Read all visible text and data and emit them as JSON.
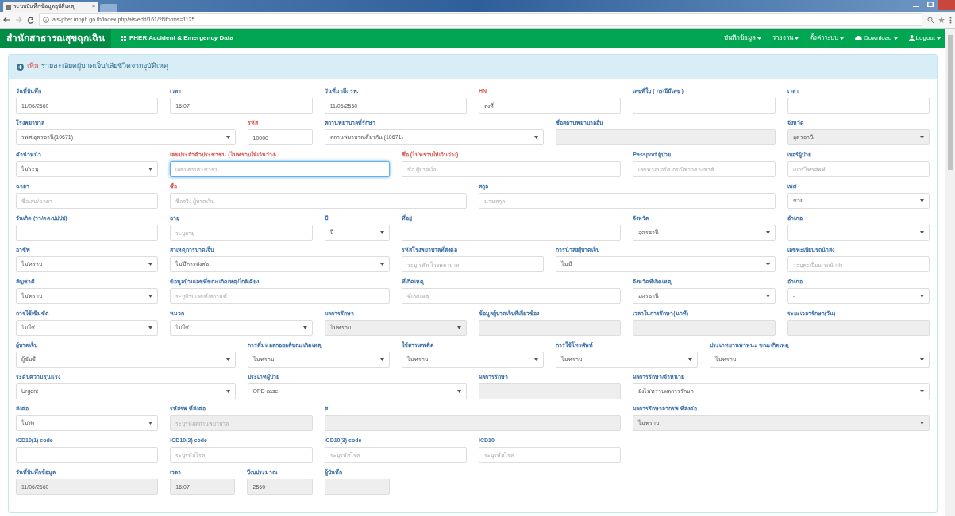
{
  "browser": {
    "tab_title": "ระบบบันทึกข้อมูลอุบัติเหตุ",
    "tab_close": "×",
    "url": "ais-pher.moph.go.th/index.php/ais/edit/161/?Nforms=1125"
  },
  "navbar": {
    "brand": "สำนักสาธารณสุขฉุกเฉิน",
    "subtitle": "PHER Accident & Emergency Data",
    "menu": [
      {
        "label": "บันทึกข้อมูล",
        "kind": "plain"
      },
      {
        "label": "รายงาน",
        "kind": "plain"
      },
      {
        "label": "ตั้งค่าระบบ",
        "kind": "plain"
      },
      {
        "label": "Download",
        "kind": "download"
      },
      {
        "label": "Logout",
        "kind": "account"
      }
    ]
  },
  "panel": {
    "title_action": "เพิ่ม",
    "title": "รายละเอียดผู้บาดเจ็บ/เสียชีวิตจากอุบัติเหตุ"
  },
  "form": {
    "rows": [
      {
        "fields": [
          {
            "kind": "text",
            "label": "วันที่บันทึก",
            "value": "11/06/2560",
            "required": false,
            "disabled": false,
            "focused": false
          },
          {
            "kind": "text",
            "label": "เวลา",
            "value": "16:07",
            "required": false,
            "disabled": false,
            "focused": false
          },
          {
            "kind": "text",
            "label": "วันที่มาถึง รพ.",
            "value": "11/06/2560",
            "required": false,
            "disabled": false,
            "focused": false
          },
          {
            "kind": "text",
            "label": "HN",
            "value": "ลงที่",
            "required": true,
            "disabled": false,
            "focused": false
          },
          {
            "kind": "text",
            "label": "เลขที่ใบ ( กรณีมีเลข )",
            "required": false,
            "disabled": false,
            "focused": false
          },
          {
            "kind": "text",
            "label": "เวลา",
            "required": false,
            "disabled": false,
            "focused": false
          }
        ]
      },
      {
        "fields": [
          {
            "kind": "select",
            "label": "โรงพยาบาล",
            "value": "รพศ.อุดรธานี(10671)",
            "required": false,
            "disabled": false,
            "focused": false
          },
          {
            "kind": "text",
            "label": "รหัส",
            "value": "10000",
            "required": true,
            "disabled": false,
            "focused": false
          },
          {
            "kind": "select",
            "label": "สถานพยาบาลที่รักษา",
            "value": "สถานพยาบาลเดียวกัน (10671)",
            "required": false,
            "disabled": false,
            "focused": false
          },
          {
            "kind": "text",
            "label": "ชื่อสถานพยาบาลอื่น",
            "required": false,
            "disabled": true,
            "focused": false
          },
          {
            "kind": "select",
            "label": "จังหวัด",
            "value": "อุดรธานี",
            "required": false,
            "disabled": true,
            "focused": false
          }
        ]
      },
      {
        "fields": [
          {
            "kind": "select",
            "label": "คำนำหน้า",
            "value": "ไม่ระบุ",
            "required": false,
            "disabled": false,
            "focused": false
          },
          {
            "kind": "text",
            "label": "เลขประจำตัวประชาชน (ไม่ทราบให้เว้นว่าง)",
            "placeholder": "เลขบัตรประชาชน",
            "required": true,
            "disabled": false,
            "focused": true
          },
          {
            "kind": "text",
            "label": "ชื่อ (ไม่ทราบให้เว้นว่าง)",
            "placeholder": "ชื่อ ผู้บาดเจ็บ",
            "required": true,
            "disabled": false,
            "focused": false
          },
          {
            "kind": "text",
            "label": "Passport ผู้ป่วย",
            "placeholder": "เลขพาสปอร์ต กรณีชาวต่างชาติ",
            "required": false,
            "disabled": false,
            "focused": false
          },
          {
            "kind": "text",
            "label": "เบอร์ผู้ป่วย",
            "placeholder": "เบอร์โทรศัพท์",
            "required": false,
            "disabled": false,
            "focused": false
          }
        ]
      },
      {
        "fields": [
          {
            "kind": "text",
            "label": "ฉายา",
            "placeholder": "ชื่อเล่น/ฉายา",
            "required": false,
            "disabled": false,
            "focused": false
          },
          {
            "kind": "text",
            "label": "ชื่อ",
            "placeholder": "ชื่อจริง ผู้บาดเจ็บ",
            "required": true,
            "disabled": false,
            "focused": false
          },
          {
            "kind": "text",
            "label": "สกุล",
            "placeholder": "นามสกุล",
            "required": false,
            "disabled": false,
            "focused": false
          },
          {
            "kind": "select",
            "label": "เพศ",
            "value": "ชาย",
            "required": false,
            "disabled": false,
            "focused": false
          }
        ]
      },
      {
        "fields": [
          {
            "kind": "text",
            "label": "วันเกิด (วว/ดด/ปปปป)",
            "required": false,
            "disabled": false,
            "focused": false
          },
          {
            "kind": "text",
            "label": "อายุ",
            "placeholder": "ระบุอายุ",
            "required": false,
            "disabled": false,
            "focused": false
          },
          {
            "kind": "select",
            "label": "ปี",
            "value": "ปี",
            "required": false,
            "disabled": false,
            "focused": false
          },
          {
            "kind": "text",
            "label": "ที่อยู่",
            "required": false,
            "disabled": false,
            "focused": false
          },
          {
            "kind": "select",
            "label": "จังหวัด",
            "value": "อุดรธานี",
            "required": false,
            "disabled": false,
            "focused": false
          },
          {
            "kind": "select",
            "label": "อำเภอ",
            "value": "-",
            "required": false,
            "disabled": false,
            "focused": false
          }
        ]
      },
      {
        "fields": [
          {
            "kind": "select",
            "label": "อาชีพ",
            "value": "ไม่ทราบ",
            "required": false,
            "disabled": false,
            "focused": false
          },
          {
            "kind": "select",
            "label": "สาเหตุการบาดเจ็บ",
            "value": "ไม่มีการส่งต่อ",
            "required": false,
            "disabled": false,
            "focused": false
          },
          {
            "kind": "text",
            "label": "รหัสโรงพยาบาลที่ส่งต่อ",
            "placeholder": "ระบุ รหัส โรงพยาบาล",
            "required": false,
            "disabled": false,
            "focused": false
          },
          {
            "kind": "select",
            "label": "การนำส่งผู้บาดเจ็บ",
            "value": "ไม่มี",
            "required": false,
            "disabled": false,
            "focused": false
          },
          {
            "kind": "text",
            "label": "เลขทะเบียนรถนำส่ง",
            "placeholder": "ระบุทะเบียน รถนำส่ง",
            "required": false,
            "disabled": false,
            "focused": false
          }
        ]
      },
      {
        "fields": [
          {
            "kind": "select",
            "label": "สัญชาติ",
            "value": "ไม่ทราบ",
            "required": false,
            "disabled": false,
            "focused": false
          },
          {
            "kind": "text",
            "label": "ข้อมูลบ้านเลขที่ขณะเกิดเหตุ/ใกล้เคียง",
            "placeholder": "ระบุบ้านเลขที่/สถานที่",
            "required": false,
            "disabled": false,
            "focused": false
          },
          {
            "kind": "text",
            "label": "ที่เกิดเหตุ",
            "placeholder": "ที่เกิดเหตุ",
            "required": false,
            "disabled": false,
            "focused": false
          },
          {
            "kind": "select",
            "label": "จังหวัดที่เกิดเหตุ",
            "value": "อุดรธานี",
            "required": false,
            "disabled": false,
            "focused": false
          },
          {
            "kind": "select",
            "label": "อำเภอ",
            "value": "-",
            "required": false,
            "disabled": false,
            "focused": false
          }
        ]
      },
      {
        "fields": [
          {
            "kind": "select",
            "label": "การใช้เข็มขัด",
            "value": "ไม่ใช่",
            "required": false,
            "disabled": false,
            "focused": false
          },
          {
            "kind": "select",
            "label": "หมวก",
            "value": "ไม่ใช่",
            "required": false,
            "disabled": false,
            "focused": false
          },
          {
            "kind": "select",
            "label": "ผลการรักษา",
            "value": "ไม่ทราบ",
            "required": false,
            "disabled": true,
            "focused": false
          },
          {
            "kind": "text",
            "label": "ข้อมูลผู้บาดเจ็บที่เกี่ยวข้อง",
            "required": false,
            "disabled": true,
            "focused": false
          },
          {
            "kind": "text",
            "label": "เวลาในการรักษา(นาที)",
            "required": false,
            "disabled": true,
            "focused": false
          },
          {
            "kind": "text",
            "label": "ระยะเวลารักษา(วัน)",
            "required": false,
            "disabled": true,
            "focused": false
          }
        ]
      },
      {
        "fields": [
          {
            "kind": "select",
            "label": "ผู้บาดเจ็บ",
            "value": "ผู้ขับขี่",
            "required": false,
            "disabled": false,
            "focused": false
          },
          {
            "kind": "select",
            "label": "การดื่มแอลกอฮอล์ขณะเกิดเหตุ",
            "value": "ไม่ทราบ",
            "required": false,
            "disabled": false,
            "focused": false
          },
          {
            "kind": "select",
            "label": "ใช้สารเสพติด",
            "value": "ไม่ทราบ",
            "required": false,
            "disabled": false,
            "focused": false
          },
          {
            "kind": "select",
            "label": "การใช้โทรศัพท์",
            "value": "ไม่ทราบ",
            "required": false,
            "disabled": false,
            "focused": false
          },
          {
            "kind": "select",
            "label": "ประเภทยานพาหนะ ขณะเกิดเหตุ",
            "value": "ไม่ทราบ",
            "required": false,
            "disabled": false,
            "focused": false
          }
        ]
      },
      {
        "fields": [
          {
            "kind": "select",
            "label": "ระดับความรุนแรง",
            "value": "Urgent",
            "required": false,
            "disabled": false,
            "focused": false
          },
          {
            "kind": "select",
            "label": "ประเภทผู้ป่วย",
            "value": "OPD case",
            "required": false,
            "disabled": false,
            "focused": false
          },
          {
            "kind": "text",
            "label": "ผลการรักษา",
            "required": false,
            "disabled": true,
            "focused": false
          },
          {
            "kind": "select",
            "label": "ผลการรักษา/จำหน่าย",
            "value": "ยังไม่ทราบผลการรักษา",
            "required": false,
            "disabled": false,
            "focused": false
          }
        ]
      },
      {
        "fields": [
          {
            "kind": "select",
            "label": "ส่งต่อ",
            "value": "ไม่ส่ง",
            "required": false,
            "disabled": false,
            "focused": false
          },
          {
            "kind": "text",
            "label": "รหัสรพ.ที่ส่งต่อ",
            "placeholder": "ระบุรหัสสถานพยาบาล",
            "required": false,
            "disabled": true,
            "focused": false
          },
          {
            "kind": "text",
            "label": "ส",
            "required": false,
            "disabled": true,
            "focused": false
          },
          {
            "kind": "select",
            "label": "ผลการรักษาจากรพ.ที่ส่งต่อ",
            "value": "ไม่ทราบ",
            "required": false,
            "disabled": true,
            "focused": false
          }
        ]
      },
      {
        "fields": [
          {
            "kind": "text",
            "label": "ICD10(1) code",
            "required": false,
            "disabled": false,
            "focused": false
          },
          {
            "kind": "text",
            "label": "ICD10(2) code",
            "placeholder": "ระบุรหัสโรค",
            "required": false,
            "disabled": false,
            "focused": false
          },
          {
            "kind": "text",
            "label": "ICD10(3) code",
            "placeholder": "ระบุรหัสโรค",
            "required": false,
            "disabled": false,
            "focused": false
          },
          {
            "kind": "text",
            "label": "ICD10",
            "placeholder": "ระบุรหัสโรค",
            "required": false,
            "disabled": false,
            "focused": false
          }
        ]
      },
      {
        "fields": [
          {
            "kind": "text",
            "label": "วันที่บันทึกข้อมูล",
            "value": "11/06/2560",
            "required": false,
            "disabled": true,
            "focused": false
          },
          {
            "kind": "text",
            "label": "เวลา",
            "value": "16:07",
            "required": false,
            "disabled": true,
            "focused": false
          },
          {
            "kind": "text",
            "label": "ปีงบประมาณ",
            "value": "2560",
            "required": false,
            "disabled": true,
            "focused": false
          },
          {
            "kind": "text",
            "label": "ผู้บันทึก",
            "required": false,
            "disabled": true,
            "focused": false
          }
        ]
      }
    ]
  }
}
